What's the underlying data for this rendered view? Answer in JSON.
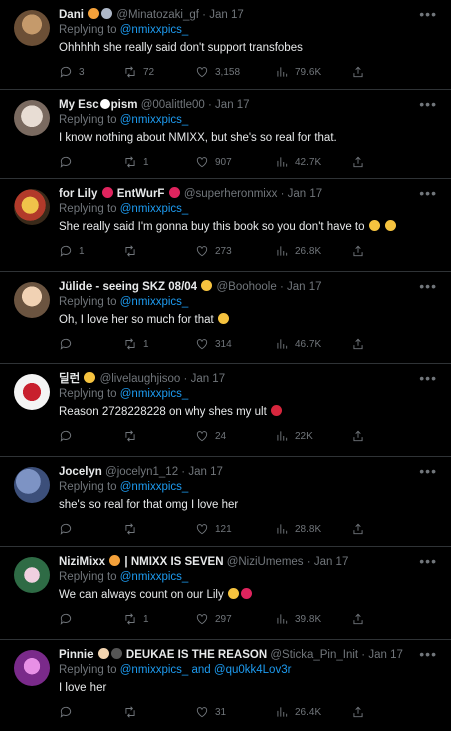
{
  "tweets": [
    {
      "name": "Dani",
      "handle": "@Minatozaki_gf",
      "date": "Jan 17",
      "replying": "Replying to",
      "mentions": [
        "@nmixxpics_"
      ],
      "text": "Ohhhhh she really said don't support transfobes",
      "replies": "3",
      "retweets": "72",
      "likes": "3,158",
      "views": "79.6K",
      "avatar_color": "#8b6a4e",
      "emojis": [
        "#f4a13a",
        "#aeb8c8"
      ]
    },
    {
      "name": "My Esc",
      "name_suffix": "pism",
      "handle": "@00alittle00",
      "date": "Jan 17",
      "replying": "Replying to",
      "mentions": [
        "@nmixxpics_"
      ],
      "text": "I know nothing about NMIXX, but she's so real for that.",
      "replies": "",
      "retweets": "1",
      "likes": "907",
      "views": "42.7K",
      "avatar_color": "#cfc6c0"
    },
    {
      "name": "for Lily",
      "name_suffix": "EntWurF",
      "handle": "@superheronmixx",
      "date": "Jan 17",
      "replying": "Replying to",
      "mentions": [
        "@nmixxpics_"
      ],
      "text": "She really said I'm gonna buy this book so you don't have to",
      "replies": "1",
      "retweets": "",
      "likes": "273",
      "views": "26.8K",
      "avatar_color": "#c9a23a",
      "emojis": [
        "#e0245e",
        "#e0245e",
        "#f6c33f",
        "#f6c33f"
      ]
    },
    {
      "name": "Jülide - seeing SKZ 08/04",
      "handle": "@Boohoole",
      "date": "Jan 17",
      "replying": "Replying to",
      "mentions": [
        "@nmixxpics_"
      ],
      "text": "Oh, I love her so much for that",
      "replies": "",
      "retweets": "1",
      "likes": "314",
      "views": "46.7K",
      "avatar_color": "#d9b48f",
      "emojis": [
        "#f6c33f",
        "#f6c33f"
      ]
    },
    {
      "name": "딜런",
      "handle": "@livelaughjisoo",
      "date": "Jan 17",
      "replying": "Replying to",
      "mentions": [
        "@nmixxpics_"
      ],
      "text": "Reason 2728228228 on why shes my ult",
      "replies": "",
      "retweets": "",
      "likes": "24",
      "views": "22K",
      "avatar_color": "#f2f2f2",
      "emojis": [
        "#f6c33f",
        "#d7263d"
      ]
    },
    {
      "name": "Jocelyn",
      "handle": "@jocelyn1_12",
      "date": "Jan 17",
      "replying": "Replying to",
      "mentions": [
        "@nmixxpics_"
      ],
      "text": "she's so real for that omg I love her",
      "replies": "",
      "retweets": "",
      "likes": "121",
      "views": "28.8K",
      "avatar_color": "#5a6f9e"
    },
    {
      "name": "NiziMixx",
      "name_suffix": "| NMIXX IS SEVEN",
      "handle": "@NiziUmemes",
      "date": "Jan 17",
      "replying": "Replying to",
      "mentions": [
        "@nmixxpics_"
      ],
      "text": "We can always count on our Lily",
      "replies": "",
      "retweets": "1",
      "likes": "297",
      "views": "39.8K",
      "avatar_color": "#3f7a52",
      "emojis": [
        "#f4a13a",
        "#f6c33f",
        "#e0245e"
      ]
    },
    {
      "name": "Pinnie",
      "name_suffix": "DEUKAE IS THE REASON",
      "handle": "@Sticka_Pin_Init",
      "date": "Jan 17",
      "replying": "Replying to",
      "mentions": [
        "@nmixxpics_",
        "@qu0kk4Lov3r"
      ],
      "mention_joiner": "and",
      "text": "I love her",
      "replies": "",
      "retweets": "",
      "likes": "31",
      "views": "26.4K",
      "avatar_color": "#b24fc4",
      "emojis": [
        "#f2d4b0",
        "#555555"
      ]
    }
  ],
  "icons": {
    "more": "more-dots-icon",
    "reply": "reply-bubble-icon",
    "retweet": "retweet-icon",
    "like": "heart-icon",
    "views": "views-bar-chart-icon",
    "share": "share-upload-icon"
  }
}
